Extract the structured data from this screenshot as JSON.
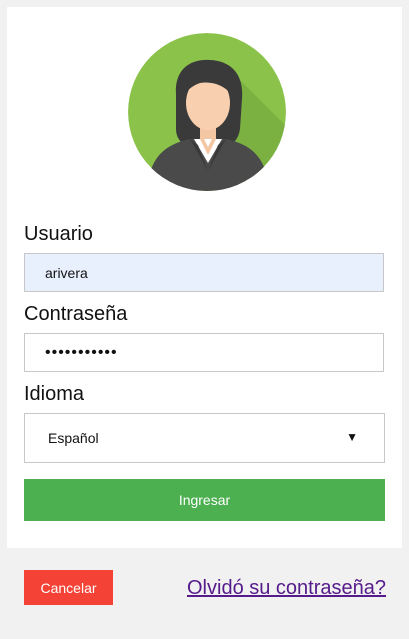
{
  "form": {
    "username_label": "Usuario",
    "username_value": "arivera",
    "password_label": "Contraseña",
    "password_value": "•••••••••••",
    "language_label": "Idioma",
    "language_selected": "Español",
    "submit_label": "Ingresar"
  },
  "footer": {
    "cancel_label": "Cancelar",
    "forgot_label": "Olvidó su contraseña?"
  },
  "icons": {
    "avatar": "user-avatar-icon",
    "select_arrow": "chevron-down-icon"
  },
  "colors": {
    "avatar_bg": "#8bc34a",
    "submit": "#4caf50",
    "cancel": "#f44336",
    "link": "#551a8b",
    "username_bg": "#e8f0fe"
  }
}
